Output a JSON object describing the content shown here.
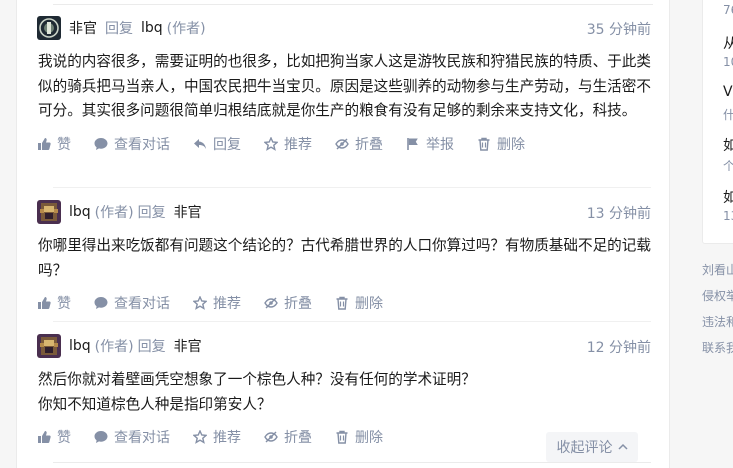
{
  "comments": [
    {
      "author": "非官",
      "reply_word": "回复",
      "reply_to": "lbq",
      "reply_to_tag": "(作者)",
      "time": "35 分钟前",
      "content": [
        "我说的内容很多，需要证明的也很多，比如把狗当家人这是游牧民族和狩猎民族的特质、于此类似的骑兵把马当亲人，中国农民把牛当宝贝。原因是这些驯养的动物参与生产劳动，与生活密不可分。其实很多问题很简单归根结底就是你生产的粮食有没有足够的剩余来支持文化，科技。"
      ],
      "actions": {
        "like": "赞",
        "view": "查看对话",
        "reply": "回复",
        "recommend": "推荐",
        "fold": "折叠",
        "report": "举报",
        "delete": "删除"
      }
    },
    {
      "author": "lbq",
      "author_tag": "(作者)",
      "reply_word": "回复",
      "reply_to": "非官",
      "time": "13 分钟前",
      "content": [
        "你哪里得出来吃饭都有问题这个结论的？古代希腊世界的人口你算过吗？有物质基础不足的记载吗？"
      ],
      "actions": {
        "like": "赞",
        "view": "查看对话",
        "recommend": "推荐",
        "fold": "折叠",
        "delete": "删除"
      }
    },
    {
      "author": "lbq",
      "author_tag": "(作者)",
      "reply_word": "回复",
      "reply_to": "非官",
      "time": "12 分钟前",
      "content": [
        "然后你就对着壁画凭空想象了一个棕色人种？没有任何的学术证明？",
        "你知不知道棕色人种是指印第安人？"
      ],
      "actions": {
        "like": "赞",
        "view": "查看对话",
        "recommend": "推荐",
        "fold": "折叠",
        "delete": "删除"
      }
    }
  ],
  "collapse_label": "收起评论",
  "sidebar": {
    "items": [
      {
        "title": "",
        "sub": "76"
      },
      {
        "title": "从",
        "sub": "10"
      },
      {
        "title": "V",
        "sub": "什"
      },
      {
        "title": "如",
        "sub": "个"
      },
      {
        "title": "如",
        "sub": "13"
      }
    ],
    "footer_links": [
      "刘看山",
      "侵权举",
      "违法和",
      "联系我"
    ]
  },
  "colors": {
    "meta": "#8590a6",
    "text": "#1a1a1a",
    "divider": "#ebebeb"
  }
}
